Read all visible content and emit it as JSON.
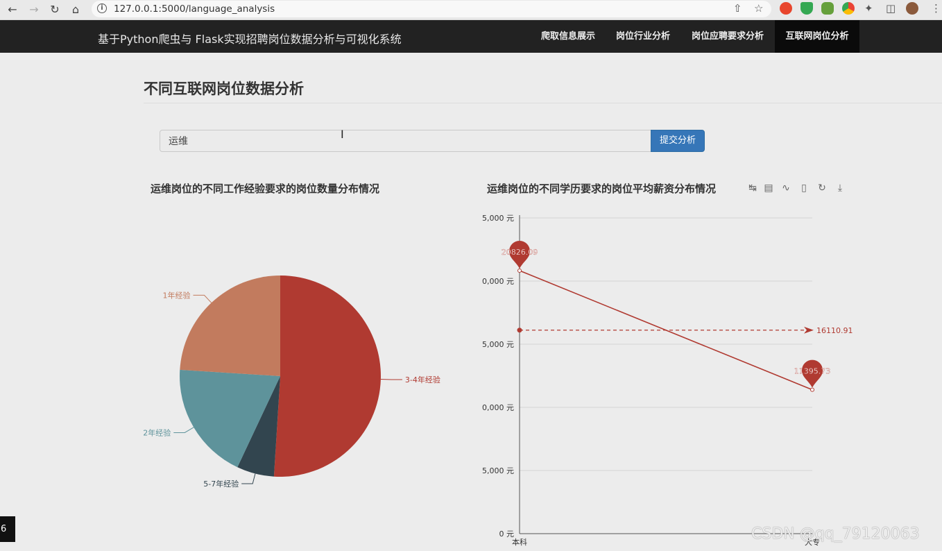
{
  "browser": {
    "url": "127.0.0.1:5000/language_analysis"
  },
  "navbar": {
    "brand": "基于Python爬虫与 Flask实现招聘岗位数据分析与可视化系统",
    "items": [
      "爬取信息展示",
      "岗位行业分析",
      "岗位应聘要求分析",
      "互联网岗位分析"
    ],
    "active_index": 3
  },
  "page": {
    "title": "不同互联网岗位数据分析"
  },
  "search": {
    "value": "运维",
    "button_label": "提交分析"
  },
  "side_tag": "6",
  "watermark": "CSDN @qq_79120063",
  "chart_data": [
    {
      "type": "pie",
      "title": "运维岗位的不同工作经验要求的岗位数量分布情况",
      "slices": [
        {
          "label": "3-4年经验",
          "value": 51,
          "color": "#b03a31"
        },
        {
          "label": "5-7年经验",
          "value": 6,
          "color": "#32454f"
        },
        {
          "label": "2年经验",
          "value": 19,
          "color": "#5e939b"
        },
        {
          "label": "1年经验",
          "value": 24,
          "color": "#c27b5e"
        }
      ]
    },
    {
      "type": "line",
      "title": "运维岗位的不同学历要求的岗位平均薪资分布情况",
      "categories": [
        "本科",
        "大专"
      ],
      "series": [
        {
          "values": [
            20826.09,
            11395.73
          ],
          "color": "#b03a31"
        }
      ],
      "mark_points": [
        "20826.09",
        "11395.73"
      ],
      "mark_line": {
        "value": 16110.91,
        "label": "16110.91"
      },
      "y_ticks": [
        "0 元",
        "5,000 元",
        "0,000 元",
        "5,000 元",
        "0,000 元",
        "5,000 元"
      ],
      "ylim": [
        0,
        25000
      ],
      "grid": true,
      "toolbox": [
        "data-zoom-icon",
        "data-view-icon",
        "line-chart-icon",
        "bar-chart-icon",
        "restore-icon",
        "save-image-icon"
      ]
    }
  ]
}
